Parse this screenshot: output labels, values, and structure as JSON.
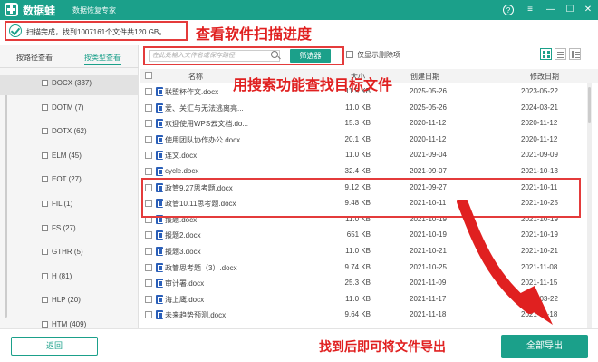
{
  "titlebar": {
    "app_name": "数据蛙",
    "subtitle": "数据恢复专家",
    "icons": [
      "help-icon",
      "menu-icon",
      "minimize-icon",
      "maximize-icon",
      "close-icon"
    ]
  },
  "status": {
    "text": "扫描完成，找到1007161个文件共120 GB。"
  },
  "annotations": {
    "progress": "查看软件扫描进度",
    "search": "用搜索功能查找目标文件",
    "export": "找到后即可将文件导出"
  },
  "sidebar": {
    "tabs": [
      {
        "label": "按路径查看"
      },
      {
        "label": "按类型查看"
      }
    ],
    "items": [
      {
        "label": "DOCX (337)"
      },
      {
        "label": "DOTM (7)"
      },
      {
        "label": "DOTX (62)"
      },
      {
        "label": "ELM (45)"
      },
      {
        "label": "EOT (27)"
      },
      {
        "label": "FIL (1)"
      },
      {
        "label": "FS (27)"
      },
      {
        "label": "GTHR (5)"
      },
      {
        "label": "H (81)"
      },
      {
        "label": "HLP (20)"
      },
      {
        "label": "HTM (409)"
      }
    ]
  },
  "toolbar": {
    "search_placeholder": "在此处输入文件名或保存路径",
    "filter_label": "筛选器",
    "deleted_only_label": "仅显示删除项"
  },
  "table": {
    "headers": [
      "名称",
      "大小",
      "创建日期",
      "修改日期"
    ],
    "rows": [
      {
        "name": "联盟杯作文.docx",
        "size": "11.9 KB",
        "created": "2025-05-26",
        "modified": "2023-05-22"
      },
      {
        "name": "爱、关汇与无法逃离亮...",
        "size": "11.0 KB",
        "created": "2025-05-26",
        "modified": "2024-03-21"
      },
      {
        "name": "欢迎使用WPS云文档.do...",
        "size": "15.3 KB",
        "created": "2020-11-12",
        "modified": "2020-11-12"
      },
      {
        "name": "使用团队协作办公.docx",
        "size": "20.1 KB",
        "created": "2020-11-12",
        "modified": "2020-11-12"
      },
      {
        "name": "连文.docx",
        "size": "11.0 KB",
        "created": "2021-09-04",
        "modified": "2021-09-09"
      },
      {
        "name": "cycle.docx",
        "size": "32.4 KB",
        "created": "2021-09-07",
        "modified": "2021-10-13"
      },
      {
        "name": "政管9.27思考题.docx",
        "size": "9.12 KB",
        "created": "2021-09-27",
        "modified": "2021-10-11"
      },
      {
        "name": "政管10.11思考题.docx",
        "size": "9.48 KB",
        "created": "2021-10-11",
        "modified": "2021-10-25"
      },
      {
        "name": "报题.docx",
        "size": "11.0 KB",
        "created": "2021-10-19",
        "modified": "2021-10-19"
      },
      {
        "name": "报题2.docx",
        "size": "651 KB",
        "created": "2021-10-19",
        "modified": "2021-10-19"
      },
      {
        "name": "报题3.docx",
        "size": "11.0 KB",
        "created": "2021-10-21",
        "modified": "2021-10-21"
      },
      {
        "name": "政管思考题（3）.docx",
        "size": "9.74 KB",
        "created": "2021-10-25",
        "modified": "2021-11-08"
      },
      {
        "name": "审计署.docx",
        "size": "25.3 KB",
        "created": "2021-11-09",
        "modified": "2021-11-15"
      },
      {
        "name": "海上鹰.docx",
        "size": "11.0 KB",
        "created": "2021-11-17",
        "modified": "2022-03-22"
      },
      {
        "name": "未来趋势预测.docx",
        "size": "9.64 KB",
        "created": "2021-11-18",
        "modified": "2021-11-18"
      }
    ]
  },
  "footer": {
    "back_label": "返回",
    "export_label": "全部导出"
  },
  "colors": {
    "accent": "#1ba08a",
    "annotation": "#e02020"
  }
}
